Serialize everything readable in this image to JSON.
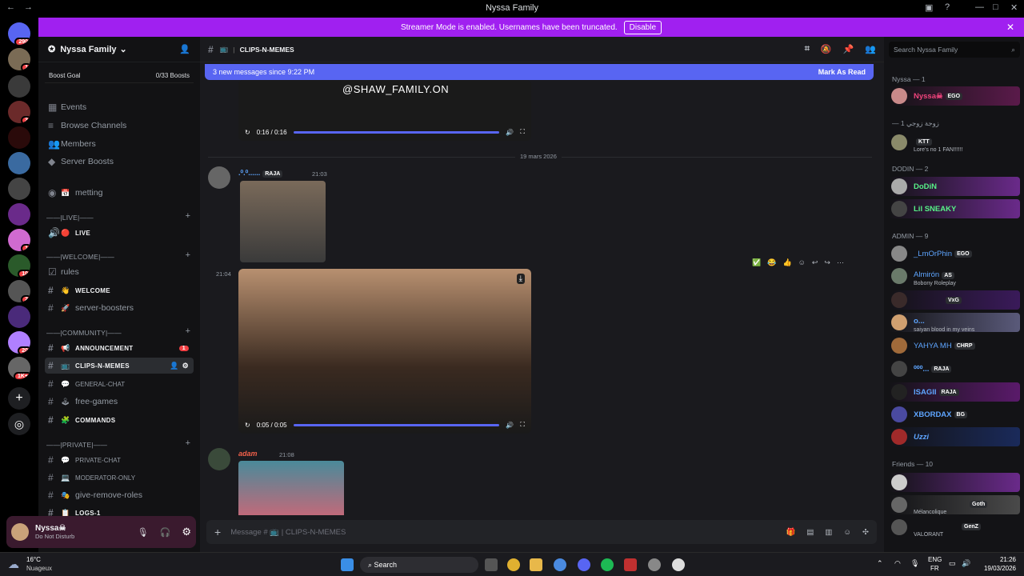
{
  "window": {
    "title": "Nyssa Family"
  },
  "servers": {
    "badges": [
      "290",
      "1",
      "3",
      "1",
      "10",
      "2",
      "20",
      "1K+"
    ]
  },
  "banner": {
    "text": "Streamer Mode is enabled. Usernames have been truncated.",
    "disable": "Disable"
  },
  "sidebar": {
    "server_name": "Nyssa Family",
    "boost_goal": "Boost Goal",
    "boost_count": "0/33 Boosts",
    "items": [
      {
        "label": "Events"
      },
      {
        "label": "Browse Channels"
      },
      {
        "label": "Members"
      },
      {
        "label": "Server Boosts"
      }
    ],
    "channels": [
      {
        "name": "metting"
      },
      {
        "cat": "——|LIVE|——"
      },
      {
        "name": "LIVE"
      },
      {
        "cat": "——|WELCOME|——"
      },
      {
        "name": "rules"
      },
      {
        "name": "WELCOME"
      },
      {
        "name": "server-boosters"
      },
      {
        "cat": "——|COMMUNITY|——"
      },
      {
        "name": "ANNOUNCEMENT",
        "badge": "1"
      },
      {
        "name": "CLIPS-N-MEMES"
      },
      {
        "name": "GENERAL-CHAT"
      },
      {
        "name": "free-games"
      },
      {
        "name": "COMMANDS"
      },
      {
        "cat": "——|PRIVATE|——"
      },
      {
        "name": "PRIVATE-CHAT"
      },
      {
        "name": "MODERATOR-ONLY"
      },
      {
        "name": "give-remove-roles"
      },
      {
        "name": "LOGS-1"
      }
    ]
  },
  "user": {
    "name": "Nyssa☠",
    "status": "Do Not Disturb"
  },
  "main": {
    "channel": "CLIPS-N-MEMES",
    "new_messages": "3 new messages since 9:22 PM",
    "mark_read": "Mark As Read",
    "video1": {
      "overlay": "@SHAW_FAMILY.ON",
      "time": "0:16 / 0:16"
    },
    "date_divider": "19 mars 2026",
    "msg1": {
      "author": ".⁰.⁰......",
      "tag": "RAJA",
      "time": "21:03"
    },
    "msg2": {
      "time": "21:04",
      "video_time": "0:05 / 0:05"
    },
    "msg3": {
      "author": "adam",
      "time": "21:08"
    },
    "composer_placeholder": "Message # 📺 | CLIPS-N-MEMES"
  },
  "members": {
    "search": "Search Nyssa Family",
    "sections": [
      {
        "title": "Nyssa — 1"
      },
      {
        "title": "— 1 زوجة زوجي"
      },
      {
        "title": "DODIN — 2"
      },
      {
        "title": "ADMIN — 9"
      },
      {
        "title": "Friends — 10"
      }
    ],
    "list": [
      {
        "name": "Nyssa☠",
        "tag": "EGO",
        "color": "#f0447c"
      },
      {
        "name": "",
        "tag": "KTT",
        "sub": "Lore's no 1 FAN!!!!!!",
        "color": "#dbdee1"
      },
      {
        "name": "DoDiN",
        "color": "#57f287"
      },
      {
        "name": "Lil SNEAKY",
        "color": "#57f287"
      },
      {
        "name": "_LmOrPhin",
        "tag": "EGO",
        "color": "#5ea5ff"
      },
      {
        "name": "Almirón",
        "tag": "AS",
        "sub": "Bobony Roleplay",
        "color": "#5ea5ff"
      },
      {
        "name": "",
        "tag": "VxG",
        "color": "#5ea5ff"
      },
      {
        "name": "o...",
        "sub": "saiyan blood in my veins",
        "color": "#5ea5ff"
      },
      {
        "name": "YAHYA MH",
        "tag": "CHRP",
        "color": "#5ea5ff"
      },
      {
        "name": "⁰⁰⁰...",
        "tag": "RAJA",
        "color": "#5ea5ff"
      },
      {
        "name": "ISAGII",
        "tag": "RAJA",
        "color": "#5ea5ff"
      },
      {
        "name": "XBORDAX",
        "tag": "BG",
        "color": "#5ea5ff"
      },
      {
        "name": "Uzzi",
        "color": "#5ea5ff"
      },
      {
        "name": "",
        "color": "#a970ff"
      },
      {
        "name": "",
        "tag": "Goth",
        "sub": "Mélancolique",
        "color": "#a970ff"
      },
      {
        "name": "",
        "tag": "GenZ",
        "sub": "VALORANT",
        "color": "#a970ff"
      }
    ]
  },
  "taskbar": {
    "weather_temp": "16°C",
    "weather_desc": "Nuageux",
    "search": "Search",
    "lang1": "ENG",
    "lang2": "FR",
    "time": "21:26",
    "date": "19/03/2026"
  }
}
